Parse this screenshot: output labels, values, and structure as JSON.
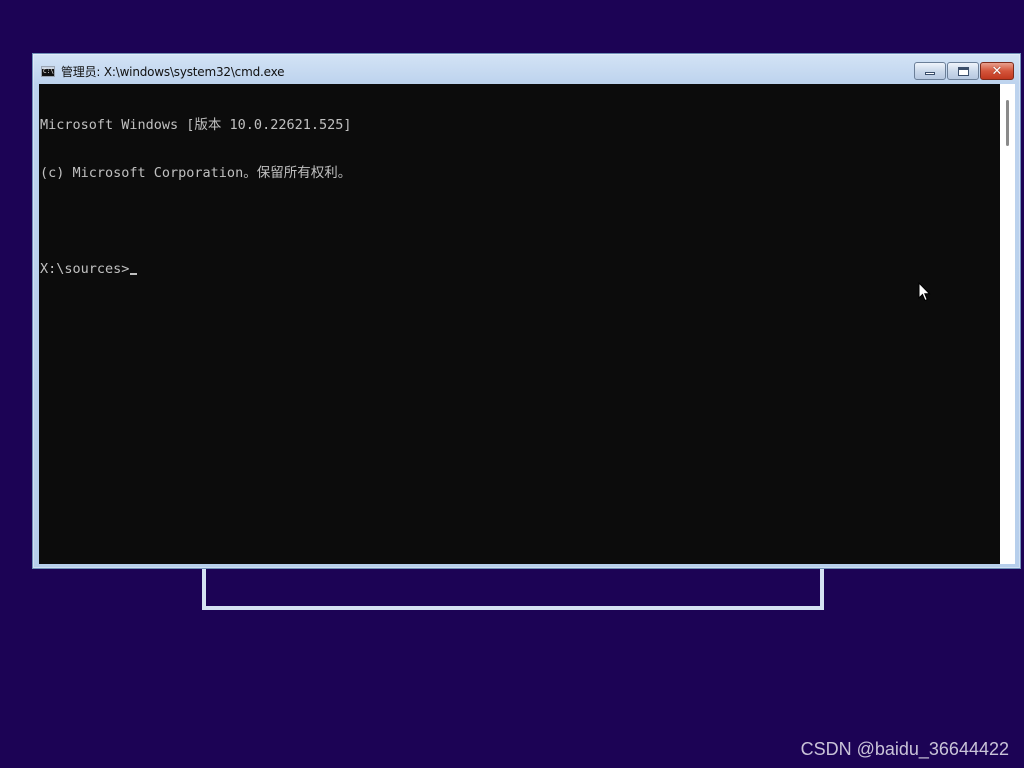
{
  "window": {
    "title": "管理员: X:\\windows\\system32\\cmd.exe",
    "icon": "cmd-icon",
    "controls": {
      "minimize": "minimize-icon",
      "maximize": "maximize-icon",
      "close": "✕"
    }
  },
  "console": {
    "lines": [
      "Microsoft Windows [版本 10.0.22621.525]",
      "(c) Microsoft Corporation。保留所有权利。",
      "",
      "X:\\sources>"
    ],
    "text_color": "#c0c0c0",
    "background": "#0c0c0c"
  },
  "desktop": {
    "background": "#1c0355"
  },
  "watermark": "CSDN @baidu_36644422"
}
